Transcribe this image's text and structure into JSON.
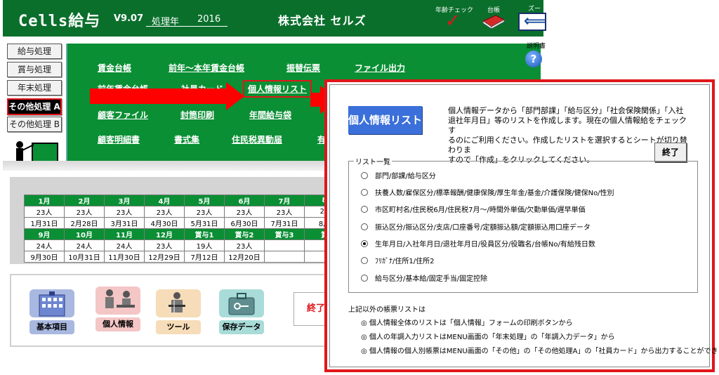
{
  "header": {
    "app_title": "Cells給与",
    "version": "V9.07",
    "year_label": "処理年",
    "year_value": "2016",
    "company": "株式会社 セルズ",
    "age_check_label": "年齢チェック",
    "ledger_label": "台帳",
    "zoom_label": "ズーム",
    "help_label": "説明書",
    "help_glyph": "?"
  },
  "left_menu": {
    "items": [
      "給与処理",
      "賞与処理",
      "年末処理",
      "その他処理 A",
      "その他処理 B"
    ]
  },
  "reports": {
    "row1": [
      "賃金台帳",
      "前年～本年賃金台帳",
      "振替伝票",
      "ファイル出力"
    ],
    "row2": [
      "前年賃金台帳",
      "社員カード",
      "個人情報リスト"
    ],
    "row3": [
      "顧客ファイル",
      "封筒印刷",
      "年間給与袋"
    ],
    "row4": [
      "顧客明細書",
      "書式集",
      "住民税異動届",
      "有"
    ]
  },
  "calendar": {
    "rows": [
      {
        "type": "hdr",
        "cells": [
          "1月",
          "2月",
          "3月",
          "4月",
          "5月",
          "6月",
          "7月",
          "8"
        ]
      },
      {
        "type": "val",
        "cells": [
          "23人",
          "23人",
          "23人",
          "23人",
          "23人",
          "23人",
          "23人",
          "23"
        ]
      },
      {
        "type": "val",
        "cells": [
          "1月31日",
          "2月28日",
          "3月31日",
          "4月30日",
          "5月31日",
          "6月30日",
          "7月31日",
          "8月"
        ]
      },
      {
        "type": "hdr",
        "cells": [
          "9月",
          "10月",
          "11月",
          "12月",
          "賞与1",
          "賞与2",
          "賞与3",
          "賞"
        ]
      },
      {
        "type": "val",
        "cells": [
          "24人",
          "24人",
          "24人",
          "23人",
          "19人",
          "23人",
          "",
          ""
        ]
      },
      {
        "type": "val",
        "cells": [
          "9月30日",
          "10月31日",
          "11月30日",
          "12月29日",
          "7月12日",
          "12月20日",
          "",
          ""
        ]
      }
    ]
  },
  "bottom": {
    "basic": "基本項目",
    "personal": "個人情報",
    "tool": "ツール",
    "save": "保存データ",
    "exit_partial": "終了"
  },
  "dialog": {
    "title_button": "個人情報リスト",
    "description": [
      "個人情報データから「部門部課」「給与区分」「社会保険関係」「入社",
      "退社年月日」等のリストを作成します。現在の個人情報給をチェックす",
      "るのにご利用ください。作成したリストを選択するとシートが切り替わりま",
      "すので「作成」をクリックしてください。"
    ],
    "close_button": "終了",
    "list_title": "リスト一覧",
    "options": [
      {
        "label": "部門/部課/給与区分",
        "selected": false
      },
      {
        "label": "扶養人数/雇保区分/標準報酬/健康保険/厚生年金/基金/介護保険/健保No/性別",
        "selected": false
      },
      {
        "label": "市区町村名/住民税6月/住民税7月～/時間外単価/欠勤単価/遅早単価",
        "selected": false
      },
      {
        "label": "振込区分/振込区分/支店/口座番号/定額振込額/定額振込用口座データ",
        "selected": false
      },
      {
        "label": "生年月日/入社年月日/退社年月日/役員区分/役職名/台帳No/有給残日数",
        "selected": true
      },
      {
        "label": "ﾌﾘｶﾞﾅ/住所1/住所2",
        "selected": false
      },
      {
        "label": "給与区分/基本給/固定手当/固定控除",
        "selected": false
      }
    ],
    "other_title": "上記以外の帳票リストは",
    "notes": [
      "◎ 個人情報全体のリストは「個人情報」フォームの印刷ボタンから",
      "◎ 個人の年調入力リストはMENU画面の「年末処理」の「年調入力データ」から",
      "◎ 個人情報の個人別帳票はMENU画面の「その他」の「その他処理A」の「社員カード」から出力することができます。"
    ]
  },
  "colors": {
    "green": "#0a8f34",
    "dark_green": "#0b6f2c",
    "red": "#e0161a",
    "blue_button": "#3b6fd9"
  }
}
